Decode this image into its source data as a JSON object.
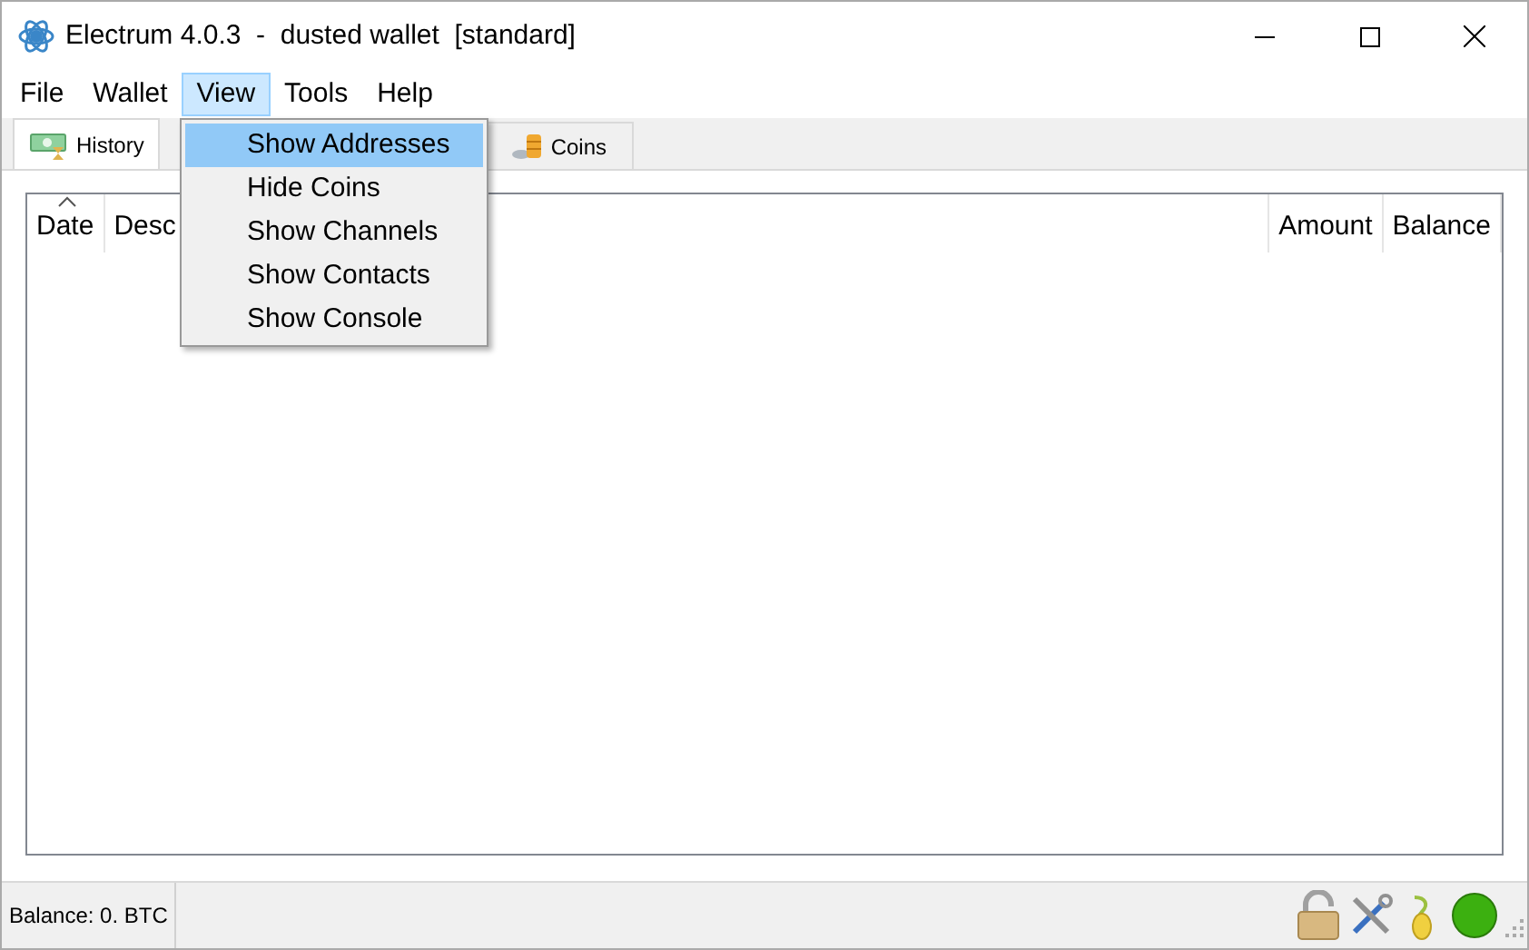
{
  "window": {
    "title": "Electrum 4.0.3  -  dusted wallet  [standard]"
  },
  "menu_bar": [
    {
      "label": "File",
      "selected": false
    },
    {
      "label": "Wallet",
      "selected": false
    },
    {
      "label": "View",
      "selected": true
    },
    {
      "label": "Tools",
      "selected": false
    },
    {
      "label": "Help",
      "selected": false
    }
  ],
  "tabs": [
    {
      "label": "History",
      "selected": true,
      "kind": "history"
    },
    {
      "label": "Coins",
      "selected": false,
      "kind": "coins"
    }
  ],
  "table": {
    "columns": [
      {
        "label": "Date",
        "sorted": true
      },
      {
        "label": "Desc",
        "sorted": false
      },
      {
        "label": "Amount",
        "sorted": false
      },
      {
        "label": "Balance",
        "sorted": false
      }
    ]
  },
  "view_menu": [
    {
      "label": "Show Addresses",
      "selected": true
    },
    {
      "label": "Hide Coins",
      "selected": false
    },
    {
      "label": "Show Channels",
      "selected": false
    },
    {
      "label": "Show Contacts",
      "selected": false
    },
    {
      "label": "Show Console",
      "selected": false
    }
  ],
  "status_bar": {
    "balance": "Balance: 0. BTC"
  }
}
